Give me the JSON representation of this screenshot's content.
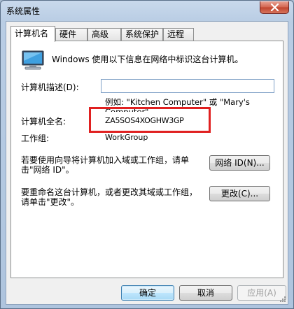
{
  "window": {
    "title": "系统属性"
  },
  "tabs": [
    {
      "label": "计算机名",
      "active": true
    },
    {
      "label": "硬件",
      "active": false
    },
    {
      "label": "高级",
      "active": false
    },
    {
      "label": "系统保护",
      "active": false
    },
    {
      "label": "远程",
      "active": false
    }
  ],
  "panel": {
    "intro": "Windows 使用以下信息在网络中标识这台计算机。",
    "description_label": "计算机描述(D):",
    "description_value": "",
    "example_line1": "例如: \"Kitchen Computer\" 或 \"Mary's",
    "example_line2": "Computer\"。",
    "fullname_label": "计算机全名:",
    "fullname_value": "ZA5SOS4XOGHW3GP",
    "workgroup_label": "工作组:",
    "workgroup_value": "WorkGroup",
    "wizard_text_line1": "若要使用向导将计算机加入域或工作组，请单",
    "wizard_text_line2": "击\"网络 ID\"。",
    "network_id_button": "网络 ID(N)...",
    "rename_text_line1": "要重命名这台计算机，或者更改其域或工作组，",
    "rename_text_line2": "请单击\"更改\"。",
    "change_button": "更改(C)..."
  },
  "footer": {
    "ok": "确定",
    "cancel": "取消",
    "apply": "应用(A)"
  },
  "colors": {
    "highlight_border": "#e02020",
    "default_button_border": "#3c7fb1"
  }
}
